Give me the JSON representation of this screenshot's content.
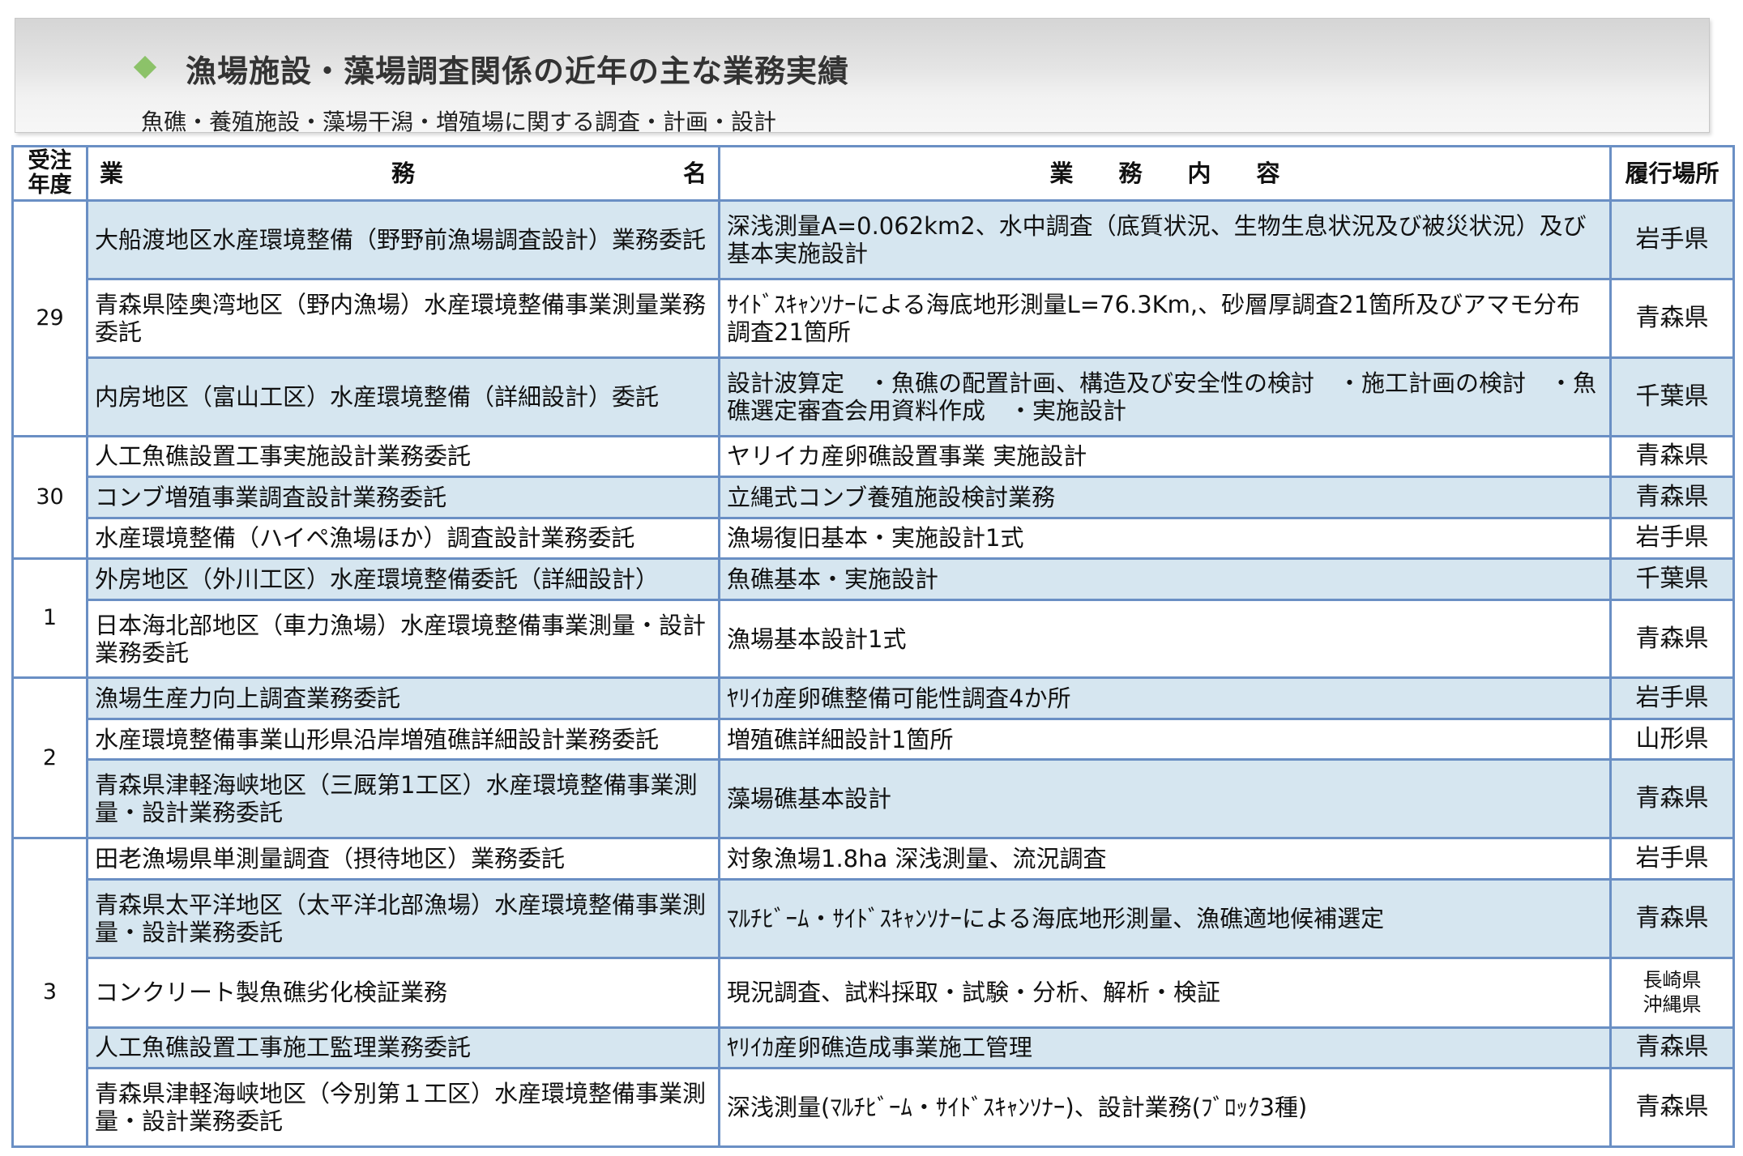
{
  "header": {
    "title": "漁場施設・藻場調査関係の近年の主な業務実績",
    "subtitle": "魚礁・養殖施設・藻場干潟・増殖場に関する調査・計画・設計"
  },
  "table": {
    "headers": {
      "year_line1": "受注",
      "year_line2": "年度",
      "name_parts": [
        "業",
        "務",
        "名"
      ],
      "content_parts": [
        "業",
        "務",
        "内",
        "容"
      ],
      "place": "履行場所"
    },
    "groups": [
      {
        "year": "29",
        "rows": [
          {
            "name": "大船渡地区水産環境整備（野野前漁場調査設計）業務委託",
            "content": "深浅測量A=0.062km2、水中調査（底質状況、生物生息状況及び被災状況）及び基本実施設計",
            "place": "岩手県"
          },
          {
            "name": "青森県陸奥湾地区（野内漁場）水産環境整備事業測量業務委託",
            "content": "ｻｲﾄﾞｽｷｬﾝｿﾅｰによる海底地形測量L=76.3Km,、砂層厚調査21箇所及びアマモ分布調査21箇所",
            "place": "青森県"
          },
          {
            "name": "内房地区（富山工区）水産環境整備（詳細設計）委託",
            "content": "設計波算定　・魚礁の配置計画、構造及び安全性の検討　・施工計画の検討　・魚礁選定審査会用資料作成　・実施設計",
            "place": "千葉県"
          }
        ]
      },
      {
        "year": "30",
        "rows": [
          {
            "name": "人工魚礁設置工事実施設計業務委託",
            "content": "ヤリイカ産卵礁設置事業 実施設計",
            "place": "青森県"
          },
          {
            "name": "コンブ増殖事業調査設計業務委託",
            "content": "立縄式コンブ養殖施設検討業務",
            "place": "青森県"
          },
          {
            "name": "水産環境整備（ハイペ漁場ほか）調査設計業務委託",
            "content": "漁場復旧基本・実施設計1式",
            "place": "岩手県"
          }
        ]
      },
      {
        "year": "1",
        "rows": [
          {
            "name": "外房地区（外川工区）水産環境整備委託（詳細設計）",
            "content": "魚礁基本・実施設計",
            "place": "千葉県"
          },
          {
            "name": "日本海北部地区（車力漁場）水産環境整備事業測量・設計業務委託",
            "content": "漁場基本設計1式",
            "place": "青森県"
          }
        ]
      },
      {
        "year": "2",
        "rows": [
          {
            "name": "漁場生産力向上調査業務委託",
            "content": "ﾔﾘｲｶ産卵礁整備可能性調査4か所",
            "place": "岩手県"
          },
          {
            "name": "水産環境整備事業山形県沿岸増殖礁詳細設計業務委託",
            "content": "増殖礁詳細設計1箇所",
            "place": "山形県"
          },
          {
            "name": "青森県津軽海峡地区（三厩第1工区）水産環境整備事業測量・設計業務委託",
            "content": "藻場礁基本設計",
            "place": "青森県"
          }
        ]
      },
      {
        "year": "3",
        "rows": [
          {
            "name": "田老漁場県単測量調査（摂待地区）業務委託",
            "content": "対象漁場1.8ha 深浅測量、流況調査",
            "place": "岩手県"
          },
          {
            "name": "青森県太平洋地区（太平洋北部漁場）水産環境整備事業測量・設計業務委託",
            "content": "ﾏﾙﾁﾋﾞｰﾑ・ｻｲﾄﾞｽｷｬﾝｿﾅｰによる海底地形測量、漁礁適地候補選定",
            "place": "青森県"
          },
          {
            "name": "コンクリート製魚礁劣化検証業務",
            "content": "現況調査、試料採取・試験・分析、解析・検証",
            "place_line1": "長崎県",
            "place_line2": "沖縄県"
          },
          {
            "name": "人工魚礁設置工事施工監理業務委託",
            "content": "ﾔﾘｲｶ産卵礁造成事業施工管理",
            "place": "青森県"
          },
          {
            "name": "青森県津軽海峡地区（今別第１工区）水産環境整備事業測量・設計業務委託",
            "content": "深浅測量(ﾏﾙﾁﾋﾞｰﾑ・ｻｲﾄﾞｽｷｬﾝｿﾅｰ)、設計業務(ﾌﾞﾛｯｸ3種)",
            "place": "青森県"
          }
        ]
      }
    ]
  }
}
